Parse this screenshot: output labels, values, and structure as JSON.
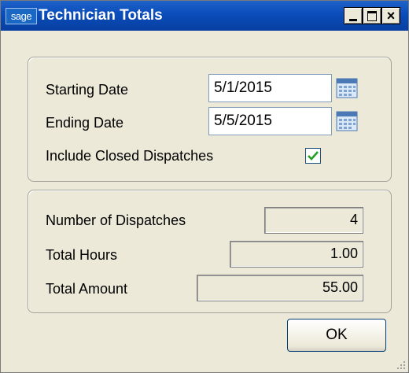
{
  "window": {
    "logo_text": "sage",
    "title": "Technician Totals"
  },
  "filters": {
    "starting_date_label": "Starting Date",
    "starting_date_value": "5/1/2015",
    "ending_date_label": "Ending Date",
    "ending_date_value": "5/5/2015",
    "include_closed_label": "Include Closed Dispatches",
    "include_closed_checked": true
  },
  "totals": {
    "dispatches_label": "Number of Dispatches",
    "dispatches_value": "4",
    "hours_label": "Total Hours",
    "hours_value": "1.00",
    "amount_label": "Total Amount",
    "amount_value": "55.00"
  },
  "buttons": {
    "ok_label": "OK"
  },
  "icons": {
    "minimize": "minimize-icon",
    "maximize": "maximize-icon",
    "close": "close-icon",
    "calendar": "calendar-icon",
    "checkmark": "checkmark-icon",
    "resize_grip": "resize-grip-icon"
  },
  "colors": {
    "titlebar": "#0a4cba",
    "window_bg": "#ece9d8",
    "check_green": "#21a121",
    "field_border": "#7f9db9"
  }
}
